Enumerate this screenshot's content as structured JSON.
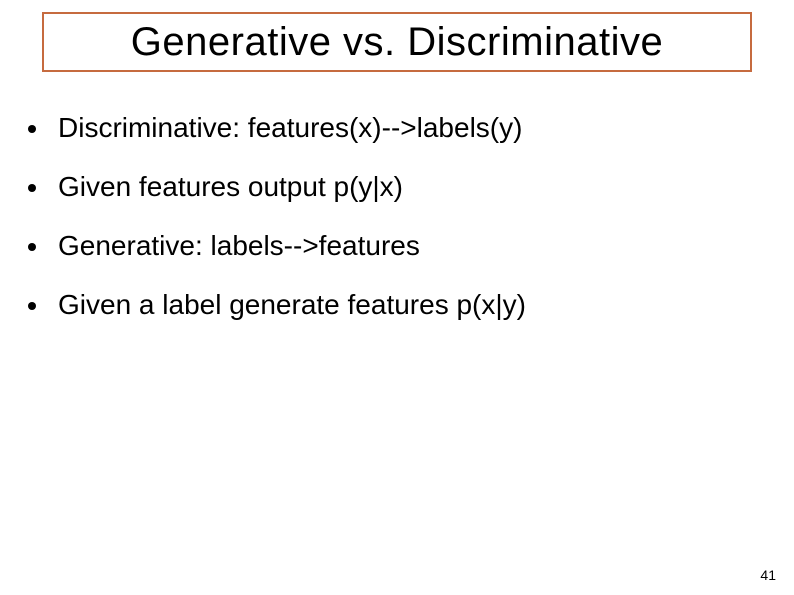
{
  "slide": {
    "title": "Generative vs. Discriminative",
    "bullets": [
      "Discriminative: features(x)-->labels(y)",
      "Given features output p(y|x)",
      "Generative: labels-->features",
      "Given a label generate features p(x|y)"
    ],
    "page_number": "41"
  }
}
